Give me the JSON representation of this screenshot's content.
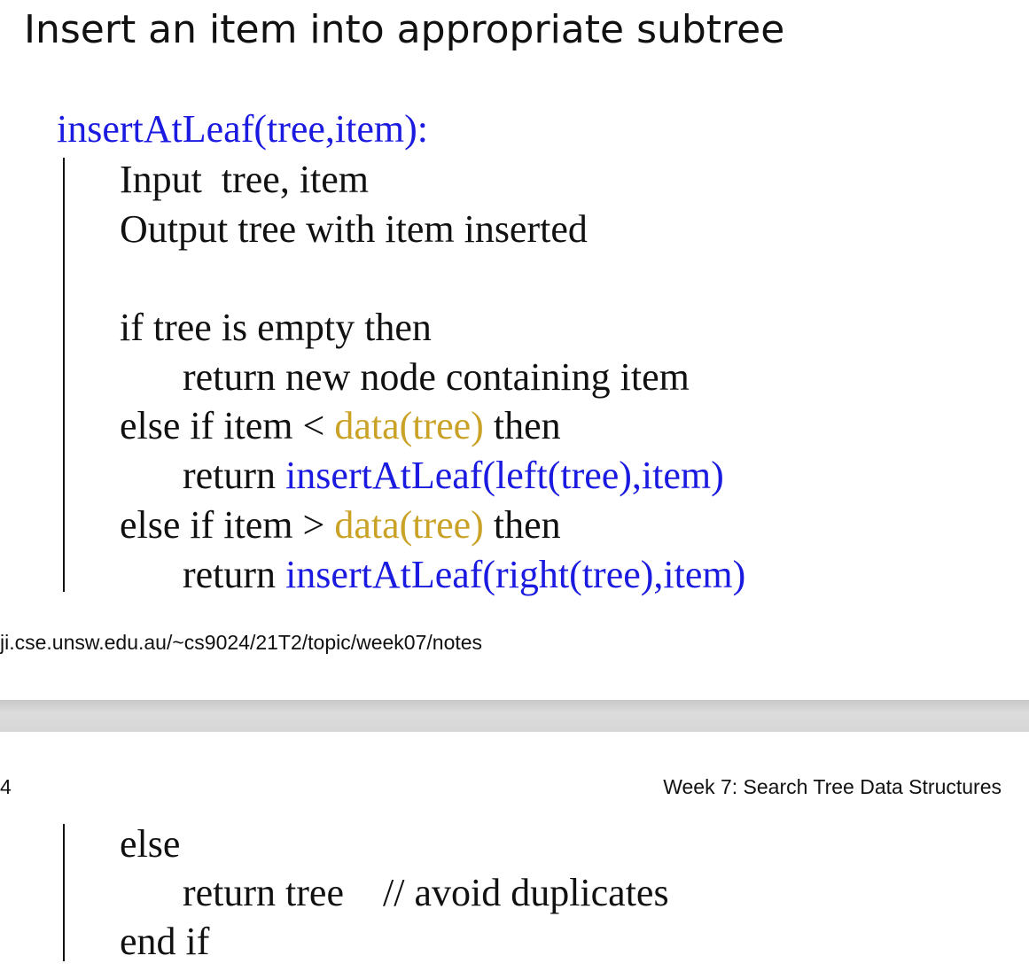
{
  "slide": {
    "title": "Insert an item into appropriate subtree"
  },
  "code": {
    "signature": "insertAtLeaf(tree,item):",
    "input_line": "Input  tree, item",
    "output_line": "Output tree with item inserted",
    "if_empty": "if tree is empty then",
    "return_new": "return new node containing item",
    "else_if_less_kw": "else if item < ",
    "data_tree": "data(tree)",
    "then_kw": " then",
    "return_kw": "return ",
    "insert_left_call": "insertAtLeaf(left(tree),item)",
    "else_if_greater_kw": "else if item > ",
    "insert_right_call": "insertAtLeaf(right(tree),item)"
  },
  "footer": {
    "url": "ji.cse.unsw.edu.au/~cs9024/21T2/topic/week07/notes"
  },
  "next_page": {
    "page_number": "4",
    "header": "Week 7: Search Tree Data Structures",
    "else_line": "else",
    "return_tree": "return tree    // avoid duplicates",
    "end_if": "end if"
  }
}
